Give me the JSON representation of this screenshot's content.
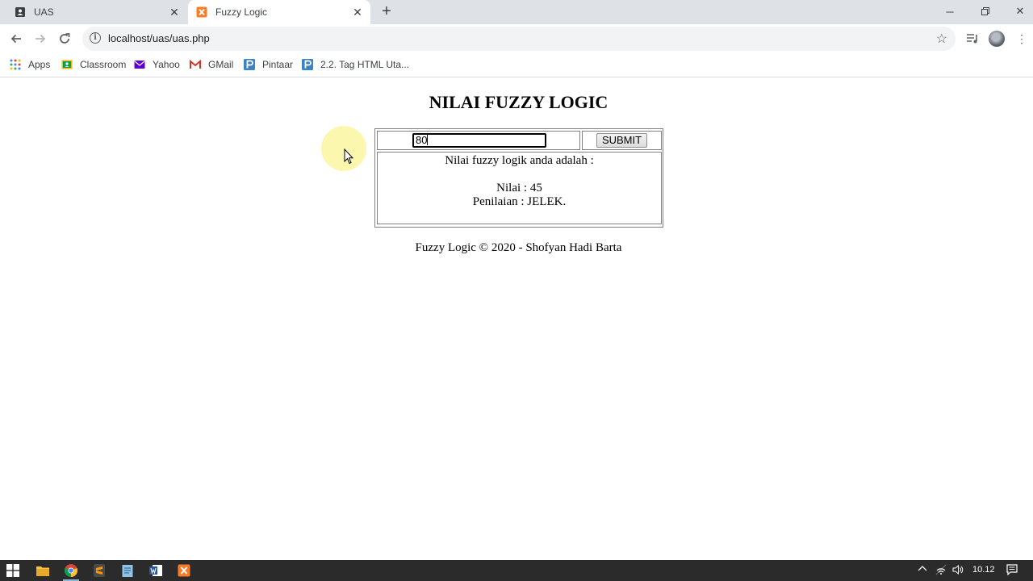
{
  "browser": {
    "tabs": [
      {
        "title": "UAS",
        "active": false,
        "icon": "contact-card-icon"
      },
      {
        "title": "Fuzzy Logic",
        "active": true,
        "icon": "xampp-icon"
      }
    ],
    "new_tab_symbol": "+",
    "url": "localhost/uas/uas.php",
    "bookmarks": [
      {
        "label": "Apps",
        "icon": "apps-grid-icon"
      },
      {
        "label": "Classroom",
        "icon": "classroom-icon"
      },
      {
        "label": "Yahoo",
        "icon": "yahoo-mail-icon"
      },
      {
        "label": "GMail",
        "icon": "gmail-icon"
      },
      {
        "label": "Pintaar",
        "icon": "pintaar-icon"
      },
      {
        "label": "2.2. Tag HTML Uta...",
        "icon": "pintaar-icon"
      }
    ]
  },
  "page": {
    "heading": "NILAI FUZZY LOGIC",
    "input_value": "80",
    "submit_label": "SUBMIT",
    "result": {
      "intro": "Nilai fuzzy logik anda adalah :",
      "nilai": "Nilai : 45",
      "penilaian": "Penilaian : JELEK."
    },
    "footer": "Fuzzy Logic © 2020 - Shofyan Hadi Barta"
  },
  "taskbar": {
    "apps": [
      "windows-start-icon",
      "file-explorer-icon",
      "chrome-icon",
      "sublime-text-icon",
      "notepad-icon",
      "word-icon",
      "xampp-icon"
    ],
    "clock": "10.12"
  },
  "colors": {
    "tabstrip": "#dee1e6",
    "omnibox": "#f1f3f4",
    "taskbar": "#2b2b2b",
    "cursor_highlight": "#faf6a0"
  }
}
